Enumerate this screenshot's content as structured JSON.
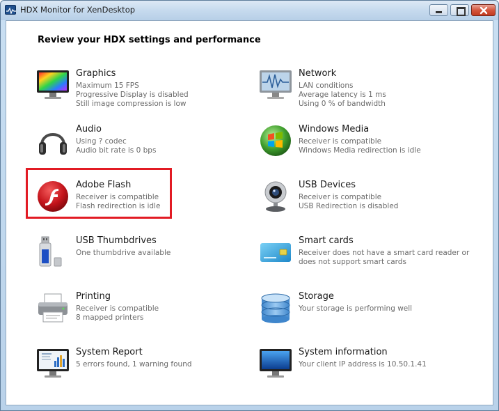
{
  "window": {
    "title": "HDX Monitor for XenDesktop"
  },
  "heading": "Review your HDX settings and performance",
  "tiles": [
    {
      "name": "Graphics",
      "icon": "monitor-icon",
      "details": [
        "Maximum 15 FPS",
        "Progressive Display is disabled",
        "Still image compression is low"
      ]
    },
    {
      "name": "Network",
      "icon": "network-monitor-icon",
      "details": [
        "LAN conditions",
        "Average latency is 1 ms",
        "Using 0 % of bandwidth"
      ]
    },
    {
      "name": "Audio",
      "icon": "headphones-icon",
      "details": [
        "Using ? codec",
        "Audio bit rate is 0 bps"
      ]
    },
    {
      "name": "Windows Media",
      "icon": "windows-media-icon",
      "details": [
        "Receiver is compatible",
        "Windows Media redirection is idle"
      ]
    },
    {
      "name": "Adobe Flash",
      "icon": "flash-icon",
      "details": [
        "Receiver is compatible",
        "Flash redirection is idle"
      ]
    },
    {
      "name": "USB Devices",
      "icon": "webcam-icon",
      "details": [
        "Receiver is compatible",
        "USB Redirection is disabled"
      ]
    },
    {
      "name": "USB Thumbdrives",
      "icon": "usb-drive-icon",
      "details": [
        "One thumbdrive available"
      ]
    },
    {
      "name": "Smart cards",
      "icon": "smart-card-icon",
      "details": [
        "Receiver does not have a smart card reader or",
        "does not support smart cards"
      ]
    },
    {
      "name": "Printing",
      "icon": "printer-icon",
      "details": [
        "Receiver is compatible",
        "8 mapped printers"
      ]
    },
    {
      "name": "Storage",
      "icon": "storage-icon",
      "details": [
        "Your storage is performing well"
      ]
    },
    {
      "name": "System Report",
      "icon": "report-monitor-icon",
      "details": [
        "5 errors found, 1 warning found"
      ]
    },
    {
      "name": "System information",
      "icon": "system-monitor-icon",
      "details": [
        "Your client IP address is 10.50.1.41"
      ]
    }
  ],
  "colors": {
    "highlight": "#e21b24",
    "flash_red": "#c4141b",
    "windows_blue": "#1f4f8d"
  }
}
